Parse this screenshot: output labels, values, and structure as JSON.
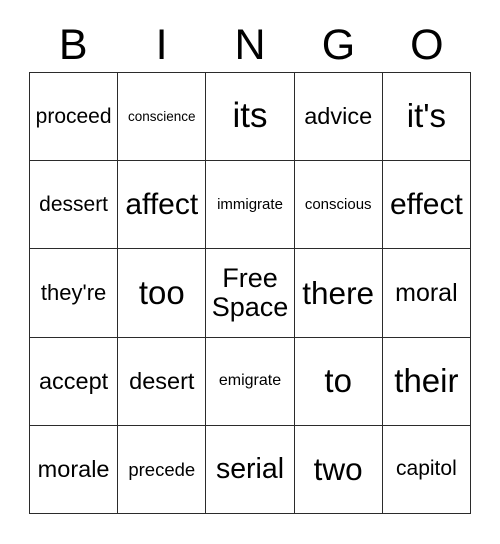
{
  "card": {
    "header_letters": [
      "B",
      "I",
      "N",
      "G",
      "O"
    ],
    "border_color": "#2b2b2b",
    "background_color": "#ffffff",
    "text_color": "#000000",
    "rows": 5,
    "columns": 5,
    "cells": [
      [
        {
          "text": "proceed",
          "size": "fs-21",
          "free": false
        },
        {
          "text": "conscience",
          "size": "fs-13",
          "free": false
        },
        {
          "text": "its",
          "size": "fs-35",
          "free": false
        },
        {
          "text": "advice",
          "size": "fs-23",
          "free": false
        },
        {
          "text": "it's",
          "size": "fs-33",
          "free": false
        }
      ],
      [
        {
          "text": "dessert",
          "size": "fs-21",
          "free": false
        },
        {
          "text": "affect",
          "size": "fs-30",
          "free": false
        },
        {
          "text": "immigrate",
          "size": "fs-15",
          "free": false
        },
        {
          "text": "conscious",
          "size": "fs-15",
          "free": false
        },
        {
          "text": "effect",
          "size": "fs-30",
          "free": false
        }
      ],
      [
        {
          "text": "they're",
          "size": "fs-22",
          "free": false
        },
        {
          "text": "too",
          "size": "fs-33",
          "free": false
        },
        {
          "text": "Free\nSpace",
          "size": "free-space",
          "free": true
        },
        {
          "text": "there",
          "size": "fs-31",
          "free": false
        },
        {
          "text": "moral",
          "size": "fs-25",
          "free": false
        }
      ],
      [
        {
          "text": "accept",
          "size": "fs-23",
          "free": false
        },
        {
          "text": "desert",
          "size": "fs-23",
          "free": false
        },
        {
          "text": "emigrate",
          "size": "fs-16",
          "free": false
        },
        {
          "text": "to",
          "size": "fs-33",
          "free": false
        },
        {
          "text": "their",
          "size": "fs-33",
          "free": false
        }
      ],
      [
        {
          "text": "morale",
          "size": "fs-23",
          "free": false
        },
        {
          "text": "precede",
          "size": "fs-18",
          "free": false
        },
        {
          "text": "serial",
          "size": "fs-28",
          "free": false
        },
        {
          "text": "two",
          "size": "fs-31",
          "free": false
        },
        {
          "text": "capitol",
          "size": "fs-21",
          "free": false
        }
      ]
    ]
  }
}
